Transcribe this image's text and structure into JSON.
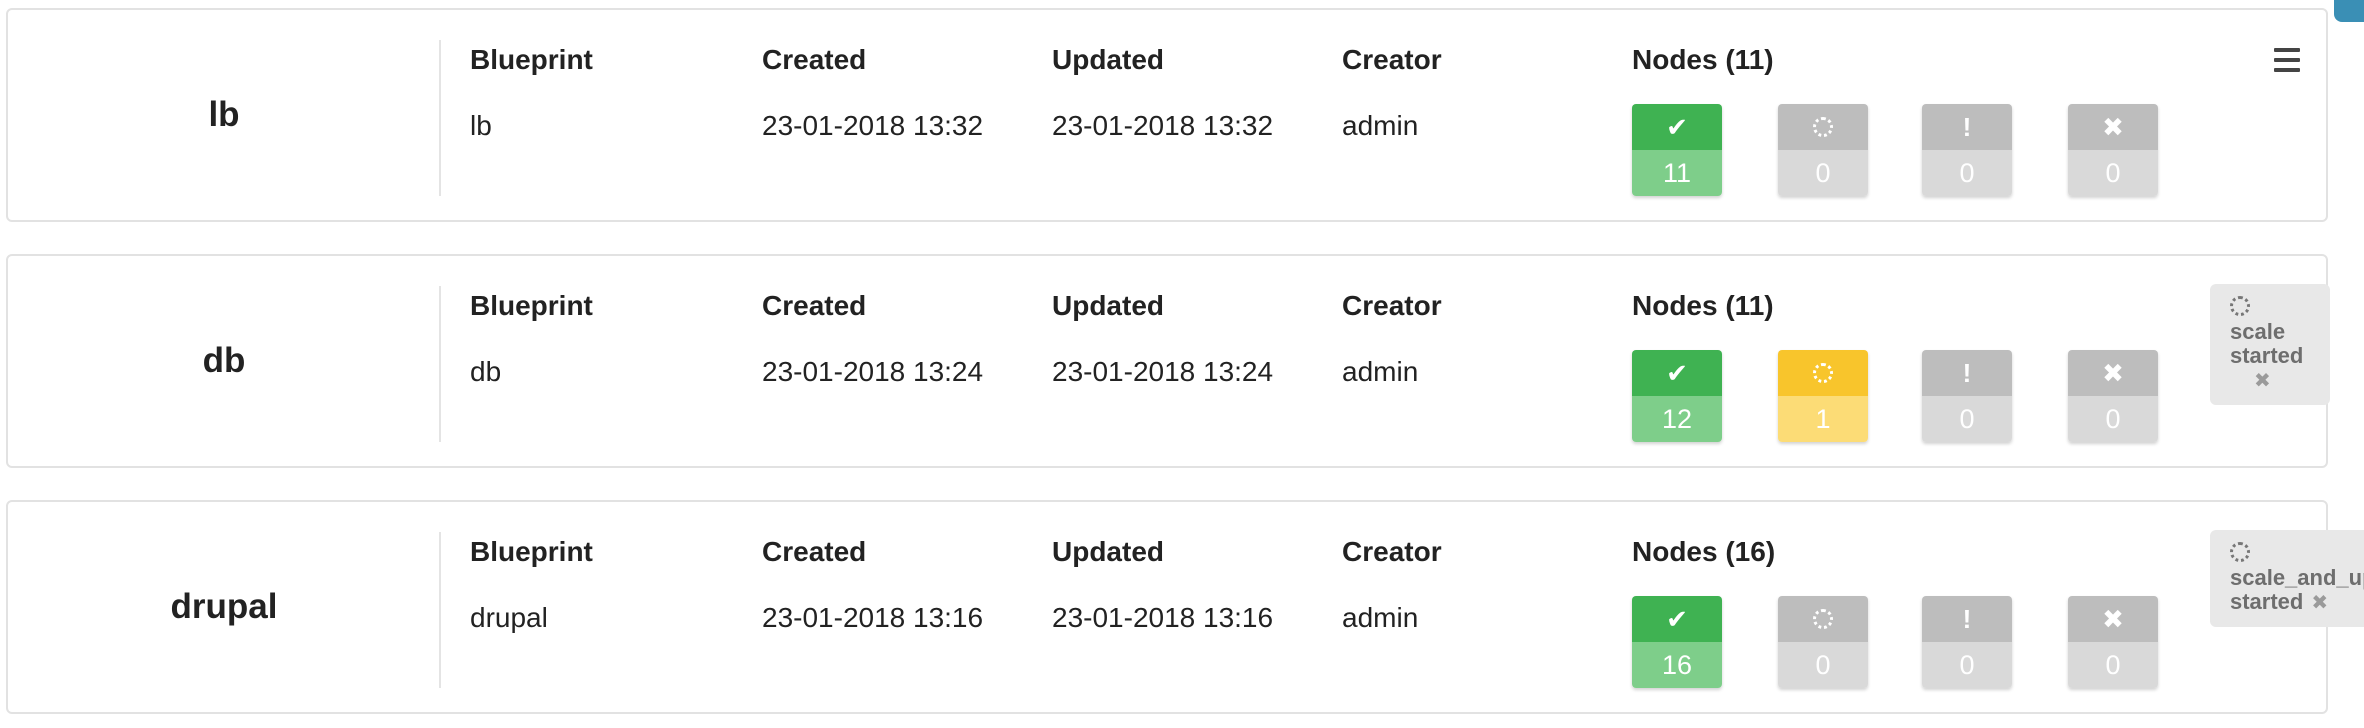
{
  "columns": {
    "blueprint": "Blueprint",
    "created": "Created",
    "updated": "Updated",
    "creator": "Creator"
  },
  "deployments": [
    {
      "name": "lb",
      "blueprint": "lb",
      "created": "23-01-2018 13:32",
      "updated": "23-01-2018 13:32",
      "creator": "admin",
      "nodes_label": "Nodes (11)",
      "node_states": [
        {
          "icon": "check-icon",
          "count": "11",
          "color": "green"
        },
        {
          "icon": "spinner-icon",
          "count": "0",
          "color": "grey"
        },
        {
          "icon": "exclamation-icon",
          "count": "0",
          "color": "grey"
        },
        {
          "icon": "x-icon",
          "count": "0",
          "color": "grey"
        }
      ]
    },
    {
      "name": "db",
      "blueprint": "db",
      "created": "23-01-2018 13:24",
      "updated": "23-01-2018 13:24",
      "creator": "admin",
      "nodes_label": "Nodes (11)",
      "node_states": [
        {
          "icon": "check-icon",
          "count": "12",
          "color": "green"
        },
        {
          "icon": "spinner-icon",
          "count": "1",
          "color": "yellow"
        },
        {
          "icon": "exclamation-icon",
          "count": "0",
          "color": "grey"
        },
        {
          "icon": "x-icon",
          "count": "0",
          "color": "grey"
        }
      ],
      "execution": {
        "workflow": "scale",
        "status": "started"
      }
    },
    {
      "name": "drupal",
      "blueprint": "drupal",
      "created": "23-01-2018 13:16",
      "updated": "23-01-2018 13:16",
      "creator": "admin",
      "nodes_label": "Nodes (16)",
      "node_states": [
        {
          "icon": "check-icon",
          "count": "16",
          "color": "green"
        },
        {
          "icon": "spinner-icon",
          "count": "0",
          "color": "grey"
        },
        {
          "icon": "exclamation-icon",
          "count": "0",
          "color": "grey"
        },
        {
          "icon": "x-icon",
          "count": "0",
          "color": "grey"
        }
      ],
      "execution": {
        "workflow": "scale_and_up",
        "status": "started"
      }
    }
  ],
  "colors": {
    "success": "#3fb252",
    "in_progress": "#f8c52c",
    "inactive": "#bdbdbd",
    "accent": "#3a8fb5"
  }
}
